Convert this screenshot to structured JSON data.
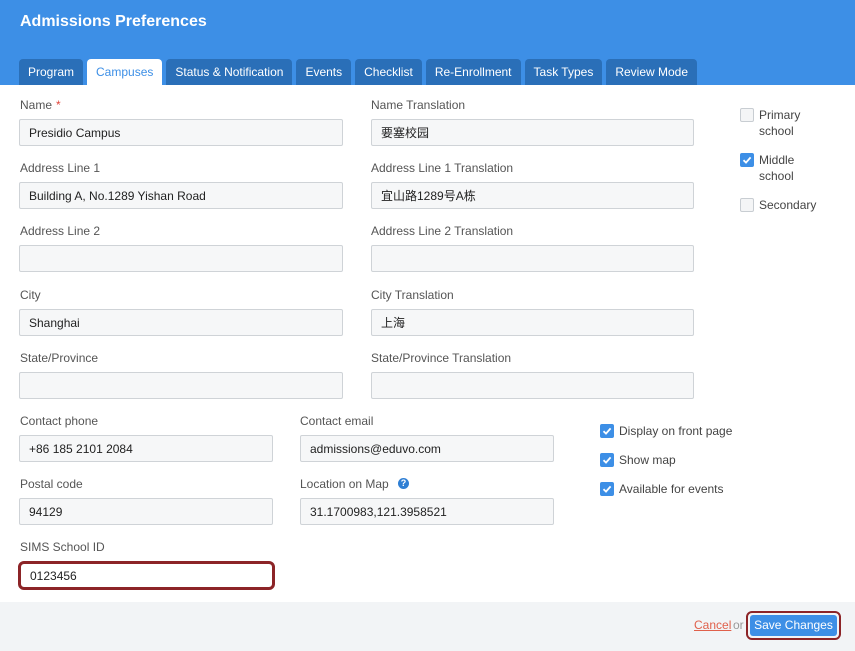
{
  "header": {
    "title": "Admissions Preferences"
  },
  "tabs": [
    {
      "label": "Program"
    },
    {
      "label": "Campuses"
    },
    {
      "label": "Status & Notification"
    },
    {
      "label": "Events"
    },
    {
      "label": "Checklist"
    },
    {
      "label": "Re-Enrollment"
    },
    {
      "label": "Task Types"
    },
    {
      "label": "Review Mode"
    }
  ],
  "active_tab": "Campuses",
  "form": {
    "name": {
      "label": "Name",
      "required_mark": "*",
      "value": "Presidio Campus"
    },
    "name_translation": {
      "label": "Name Translation",
      "value": "要塞校园"
    },
    "address1": {
      "label": "Address Line 1",
      "value": "Building A, No.1289 Yishan Road"
    },
    "address1_translation": {
      "label": "Address Line 1 Translation",
      "value": "宜山路1289号A栋"
    },
    "address2": {
      "label": "Address Line 2",
      "value": ""
    },
    "address2_translation": {
      "label": "Address Line 2 Translation",
      "value": ""
    },
    "city": {
      "label": "City",
      "value": "Shanghai"
    },
    "city_translation": {
      "label": "City Translation",
      "value": "上海"
    },
    "state": {
      "label": "State/Province",
      "value": ""
    },
    "state_translation": {
      "label": "State/Province Translation",
      "value": ""
    },
    "contact_phone": {
      "label": "Contact phone",
      "value": "+86 185 2101 2084"
    },
    "contact_email": {
      "label": "Contact email",
      "value": "admissions@eduvo.com"
    },
    "postal_code": {
      "label": "Postal code",
      "value": "94129"
    },
    "location": {
      "label": "Location on Map",
      "value": "31.1700983,121.3958521",
      "help": "?"
    },
    "sims_id": {
      "label": "SIMS School ID",
      "value": "0123456"
    }
  },
  "school_levels": [
    {
      "label": "Primary school",
      "checked": false
    },
    {
      "label": "Middle school",
      "checked": true
    },
    {
      "label": "Secondary",
      "checked": false
    }
  ],
  "options": [
    {
      "label": "Display on front page",
      "checked": true
    },
    {
      "label": "Show map",
      "checked": true
    },
    {
      "label": "Available for events",
      "checked": true
    }
  ],
  "footer": {
    "cancel_label": "Cancel",
    "or_label": "or",
    "save_label": "Save Changes"
  },
  "colors": {
    "header": "#3d8fe6",
    "tab_inactive": "#2a6fb8",
    "highlight_outline": "#8c2427",
    "cancel": "#e0604b"
  }
}
